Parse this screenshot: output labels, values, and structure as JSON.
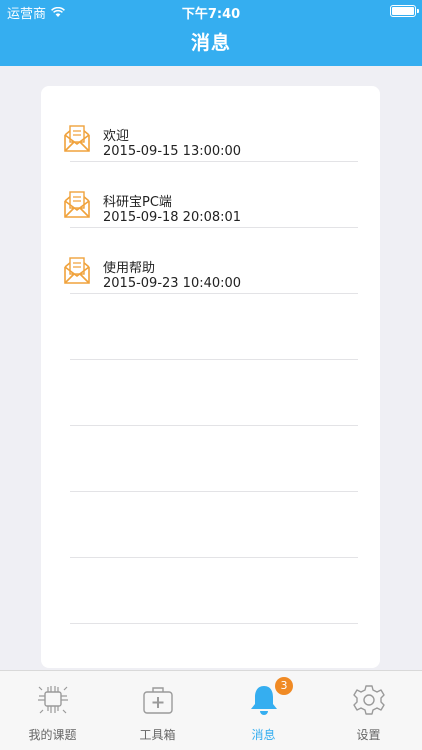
{
  "status_bar": {
    "carrier": "运营商",
    "time": "下午7:40"
  },
  "nav": {
    "title": "消息"
  },
  "messages": [
    {
      "title": "欢迎",
      "date": "2015-09-15 13:00:00"
    },
    {
      "title": "科研宝PC端",
      "date": "2015-09-18 20:08:01"
    },
    {
      "title": "使用帮助",
      "date": "2015-09-23 10:40:00"
    }
  ],
  "tabs": [
    {
      "label": "我的课题",
      "icon": "circuit-chip-icon"
    },
    {
      "label": "工具箱",
      "icon": "toolbox-icon"
    },
    {
      "label": "消息",
      "icon": "bell-icon",
      "badge": "3",
      "active": true
    },
    {
      "label": "设置",
      "icon": "gear-icon"
    }
  ],
  "colors": {
    "accent": "#35aef0",
    "envelope": "#f0a23c",
    "badge": "#f08a24"
  }
}
